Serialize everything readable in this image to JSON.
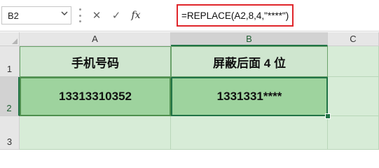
{
  "formula_bar": {
    "name_box": "B2",
    "name_box_chevron": "chevron-down-icon",
    "cancel_glyph": "✕",
    "enter_glyph": "✓",
    "function_glyph": "fx",
    "formula": "=REPLACE(A2,8,4,\"****\")"
  },
  "columns": [
    "A",
    "B",
    "C"
  ],
  "rows": [
    "1",
    "2",
    "3"
  ],
  "cells": {
    "A1": "手机号码",
    "B1": "屏蔽后面 4 位",
    "A2": "13313310352",
    "B2": "1331331****"
  },
  "selected_cell": "B2",
  "colors": {
    "accent": "#217346",
    "cell_fill": "#cfe6cf",
    "cell_fill_dark": "#9ed39e",
    "highlight_border": "#e0262b"
  }
}
